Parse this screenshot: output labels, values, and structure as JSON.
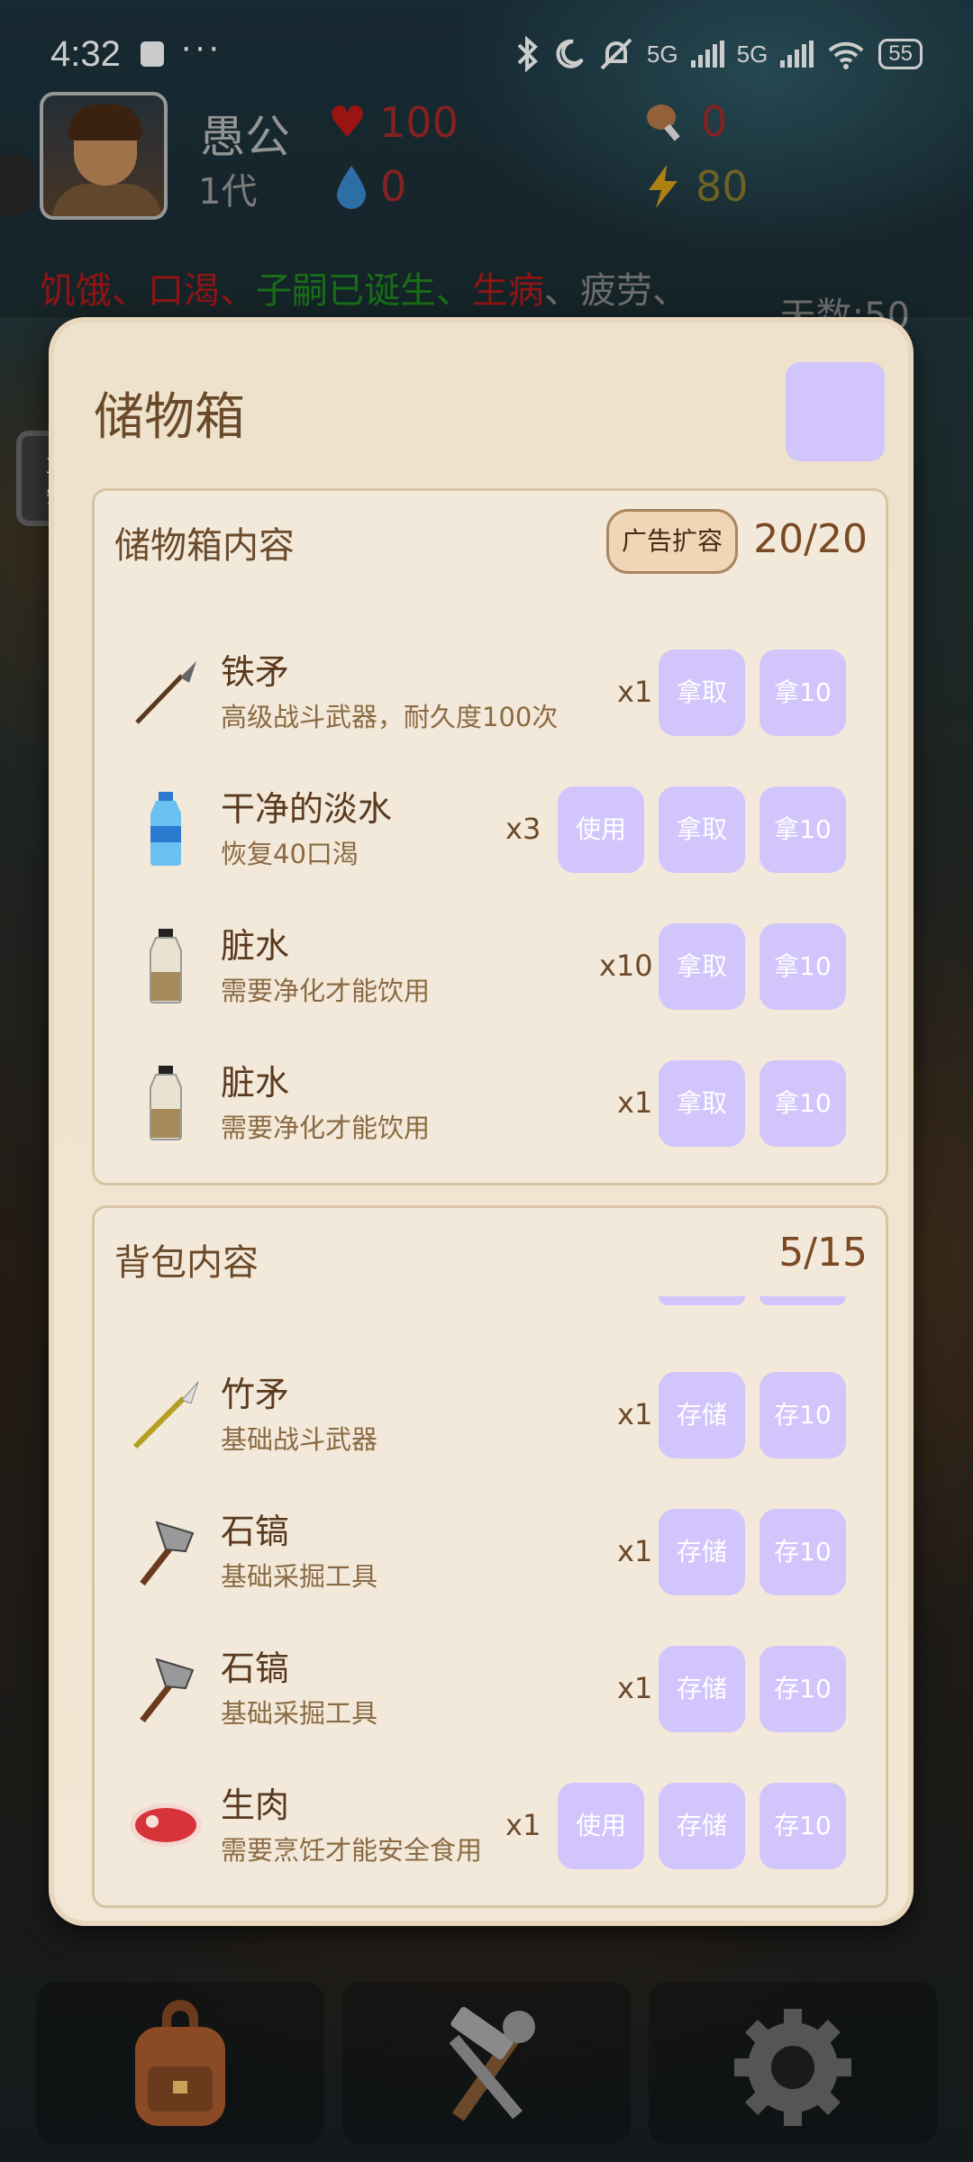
{
  "status_bar": {
    "time": "4:32",
    "dots": "···",
    "signal1": "5G",
    "signal2": "5G",
    "battery": "55"
  },
  "player": {
    "name": "愚公",
    "generation": "1代",
    "health": "100",
    "water": "0",
    "food": "0",
    "energy": "80"
  },
  "conditions": [
    {
      "text": "饥饿",
      "color": "#b51a1a"
    },
    {
      "text": "、",
      "color": "#b51a1a"
    },
    {
      "text": "口渴",
      "color": "#b51a1a"
    },
    {
      "text": "、",
      "color": "#b51a1a"
    },
    {
      "text": "子嗣已诞生",
      "color": "#1e8a1e"
    },
    {
      "text": "、",
      "color": "#1e8a1e"
    },
    {
      "text": "生病",
      "color": "#b51a1a"
    },
    {
      "text": "、",
      "color": "#888888"
    },
    {
      "text": "疲劳",
      "color": "#888888"
    },
    {
      "text": "、",
      "color": "#888888"
    }
  ],
  "days_label": "天数:50",
  "installing_label_1": "正在",
  "installing_label_2": "安装",
  "modal": {
    "title": "储物箱",
    "storage": {
      "header": "储物箱内容",
      "ad_button": "广告扩容",
      "count": "20/20",
      "items": [
        {
          "name": "铁矛",
          "desc": "高级战斗武器，耐久度100次",
          "qty": "x1",
          "icon": "iron-spear-icon",
          "use": "",
          "take": "拿取",
          "take10": "拿10"
        },
        {
          "name": "干净的淡水",
          "desc": "恢复40口渴",
          "qty": "x3",
          "icon": "water-bottle-icon",
          "use": "使用",
          "take": "拿取",
          "take10": "拿10"
        },
        {
          "name": "脏水",
          "desc": "需要净化才能饮用",
          "qty": "x10",
          "icon": "dirty-water-icon",
          "use": "",
          "take": "拿取",
          "take10": "拿10"
        },
        {
          "name": "脏水",
          "desc": "需要净化才能饮用",
          "qty": "x1",
          "icon": "dirty-water-icon",
          "use": "",
          "take": "拿取",
          "take10": "拿10"
        }
      ]
    },
    "backpack": {
      "header": "背包内容",
      "count": "5/15",
      "items": [
        {
          "name": "竹矛",
          "desc": "基础战斗武器",
          "qty": "x1",
          "icon": "bamboo-spear-icon",
          "use": "",
          "store": "存储",
          "store10": "存10"
        },
        {
          "name": "石镐",
          "desc": "基础采掘工具",
          "qty": "x1",
          "icon": "stone-pickaxe-icon",
          "use": "",
          "store": "存储",
          "store10": "存10"
        },
        {
          "name": "石镐",
          "desc": "基础采掘工具",
          "qty": "x1",
          "icon": "stone-pickaxe-icon",
          "use": "",
          "store": "存储",
          "store10": "存10"
        },
        {
          "name": "生肉",
          "desc": "需要烹饪才能安全食用",
          "qty": "x1",
          "icon": "raw-meat-icon",
          "use": "使用",
          "store": "存储",
          "store10": "存10"
        }
      ]
    }
  },
  "colors": {
    "button": "#d1c5fb",
    "modal_bg": "#efe2cc",
    "health": "#c21a1a",
    "water": "#3a8ad0",
    "energy": "#d9a018"
  }
}
